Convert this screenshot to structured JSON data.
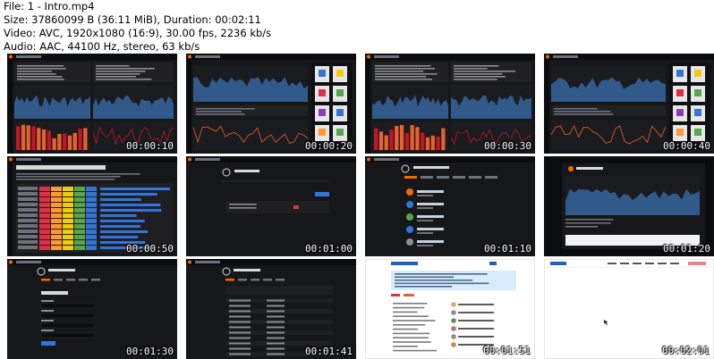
{
  "file_info": {
    "file": "File: 1 - Intro.mp4",
    "size": "Size: 37860099 B (36.11 MiB), Duration: 00:02:11",
    "video": "Video: AVC, 1920x1080 (16:9), 30.00 fps, 2236 kb/s",
    "audio": "Audio: AAC, 44100 Hz, stereo, 63 kb/s"
  },
  "thumbnails": [
    {
      "time": "00:00:10",
      "scene": "dashboard-charts"
    },
    {
      "time": "00:00:20",
      "scene": "dashboard-panels"
    },
    {
      "time": "00:00:30",
      "scene": "dashboard-charts"
    },
    {
      "time": "00:00:40",
      "scene": "dashboard-panels"
    },
    {
      "time": "00:00:50",
      "scene": "welcome-table"
    },
    {
      "time": "00:01:00",
      "scene": "warning-settings"
    },
    {
      "time": "00:01:10",
      "scene": "configuration-list"
    },
    {
      "time": "00:01:20",
      "scene": "dashboard-small"
    },
    {
      "time": "00:01:30",
      "scene": "server-admin-form"
    },
    {
      "time": "00:01:41",
      "scene": "server-admin-table"
    },
    {
      "time": "00:01:51",
      "scene": "community-page"
    },
    {
      "time": "00:02:01",
      "scene": "blank-page"
    }
  ],
  "colors": {
    "dark_bg": "#161719",
    "panel": "#212124",
    "graph_blue": "#3a6fb0",
    "bar_orange": "#e8612c",
    "bar_red": "#c4162a",
    "green": "#56a64b",
    "yellow": "#f2cc0c"
  }
}
